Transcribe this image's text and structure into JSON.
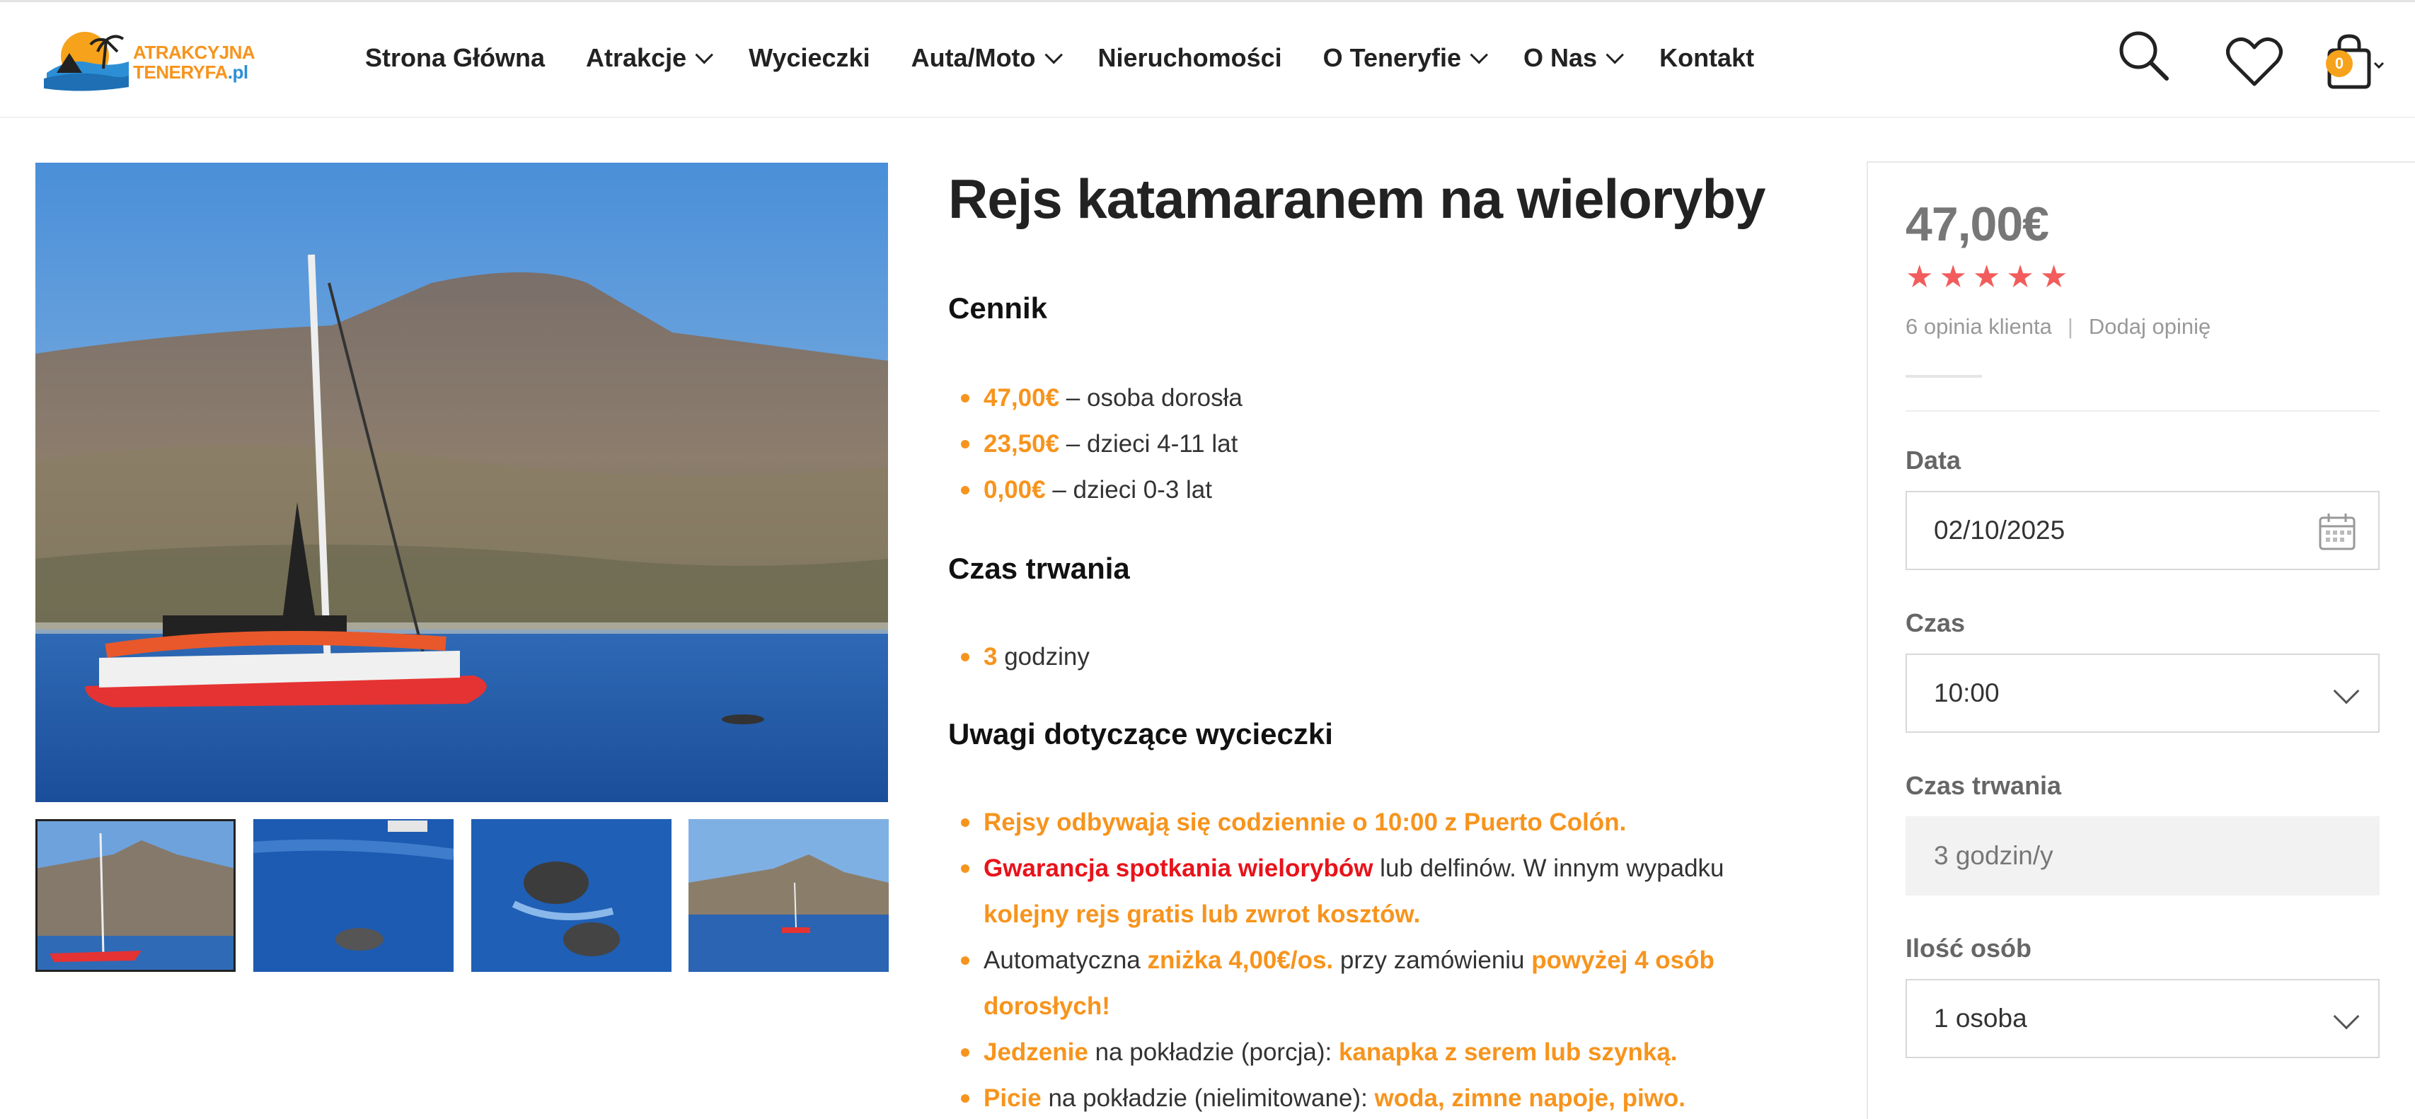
{
  "logo": {
    "line1": "ATRAKCYJNA",
    "line2_main": "TENERYFA",
    "line2_suffix": ".pl"
  },
  "nav": [
    {
      "label": "Strona Główna",
      "dropdown": false
    },
    {
      "label": "Atrakcje",
      "dropdown": true
    },
    {
      "label": "Wycieczki",
      "dropdown": false
    },
    {
      "label": "Auta/Moto",
      "dropdown": true
    },
    {
      "label": "Nieruchomości",
      "dropdown": false
    },
    {
      "label": "O Teneryfie",
      "dropdown": true
    },
    {
      "label": "O Nas",
      "dropdown": true
    },
    {
      "label": "Kontakt",
      "dropdown": false
    }
  ],
  "header": {
    "cart_count": "0",
    "icons": [
      "search-icon",
      "heart-icon",
      "cart-icon"
    ]
  },
  "gallery": {
    "thumbnails": 4,
    "active_index": 0
  },
  "product": {
    "title": "Rejs katamaranem na wieloryby",
    "pricing_heading": "Cennik",
    "pricing": [
      {
        "price": "47,00€",
        "desc": " – osoba dorosła"
      },
      {
        "price": "23,50€",
        "desc": " – dzieci 4-11 lat"
      },
      {
        "price": "0,00€",
        "desc": " – dzieci 0-3 lat"
      }
    ],
    "duration_heading": "Czas trwania",
    "duration": {
      "value": "3",
      "unit": " godziny"
    },
    "notes_heading": "Uwagi dotyczące wycieczki",
    "notes": {
      "n1": "Rejsy odbywają się codziennie o 10:00 z Puerto Colón.",
      "n2_red": "Gwarancja spotkania wielorybów",
      "n2_text": " lub delfinów. W innym wypadku",
      "n2_orange": "kolejny rejs gratis lub zwrot kosztów.",
      "n3_text1": "Automatyczna ",
      "n3_orange1": "zniżka 4,00€/os.",
      "n3_text2": " przy zamówieniu ",
      "n3_orange2": "powyżej 4 osób",
      "n3_orange3": "dorosłych!",
      "n4_orange1": "Jedzenie",
      "n4_text": " na pokładzie (porcja): ",
      "n4_orange2": "kanapka z serem lub szynką.",
      "n5_orange1": "Picie",
      "n5_text": " na pokładzie (nielimitowane): ",
      "n5_orange2": "woda, zimne napoje, piwo."
    }
  },
  "booking": {
    "price": "47,00€",
    "rating": 5,
    "reviews_text": "6 opinia klienta",
    "separator": "|",
    "add_review": "Dodaj opinię",
    "date_label": "Data",
    "date_value": "02/10/2025",
    "time_label": "Czas",
    "time_value": "10:00",
    "duration_label": "Czas trwania",
    "duration_placeholder": "3 godzin/y",
    "persons_label": "Ilość osób",
    "persons_value": "1 osoba"
  },
  "colors": {
    "accent": "#f7941d",
    "alert": "#e8131b",
    "stars": "#f25c5c"
  }
}
